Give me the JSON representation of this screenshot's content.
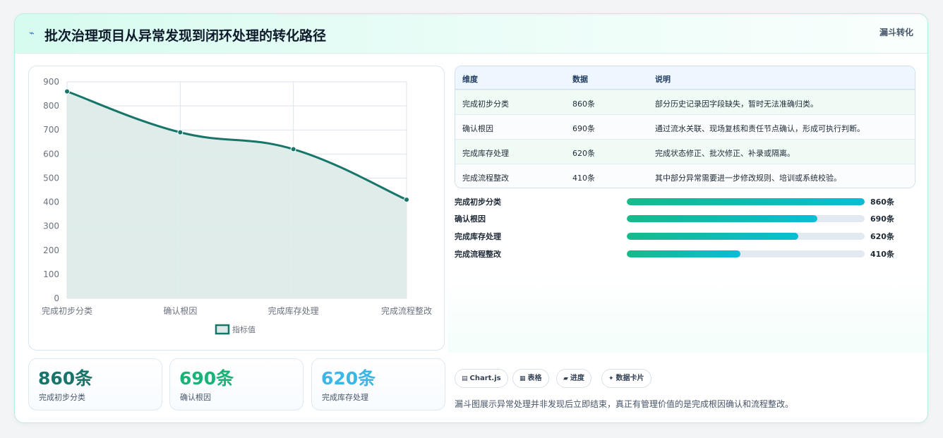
{
  "header": {
    "icon": "⌁",
    "icon_name": "trend-icon",
    "title": "批次治理项目从异常发现到闭环处理的转化路径",
    "badge": "漏斗转化"
  },
  "chart_data": {
    "type": "line",
    "categories": [
      "完成初步分类",
      "确认根因",
      "完成库存处理",
      "完成流程整改"
    ],
    "series": [
      {
        "name": "指标值",
        "values": [
          860,
          690,
          620,
          410
        ]
      }
    ],
    "ylim": [
      0,
      900
    ],
    "yticks": [
      0,
      100,
      200,
      300,
      400,
      500,
      600,
      700,
      800,
      900
    ],
    "fill": true,
    "grid": true,
    "legend": "bottom",
    "colors": {
      "line": "#17756a",
      "fill": "#dceae8",
      "grid": "#dbe3ec",
      "tick": "#6b7280"
    }
  },
  "stats": [
    {
      "value": "860条",
      "label": "完成初步分类",
      "color": "#17756a"
    },
    {
      "value": "690条",
      "label": "确认根因",
      "color": "#18b477"
    },
    {
      "value": "620条",
      "label": "完成库存处理",
      "color": "#3bb6e8"
    }
  ],
  "table": {
    "headers": [
      "维度",
      "数据",
      "说明"
    ],
    "rows": [
      [
        "完成初步分类",
        "860条",
        "部分历史记录因字段缺失，暂时无法准确归类。"
      ],
      [
        "确认根因",
        "690条",
        "通过流水关联、现场复核和责任节点确认，形成可执行判断。"
      ],
      [
        "完成库存处理",
        "620条",
        "完成状态修正、批次修正、补录或隔离。"
      ],
      [
        "完成流程整改",
        "410条",
        "其中部分异常需要进一步修改规则、培训或系统校验。"
      ]
    ]
  },
  "progress": [
    {
      "label": "完成初步分类",
      "value": 860,
      "max": 860,
      "text": "860条"
    },
    {
      "label": "确认根因",
      "value": 690,
      "max": 860,
      "text": "690条"
    },
    {
      "label": "完成库存处理",
      "value": 620,
      "max": 860,
      "text": "620条"
    },
    {
      "label": "完成流程整改",
      "value": 410,
      "max": 860,
      "text": "410条"
    }
  ],
  "chips": [
    {
      "icon": "▤",
      "icon_name": "chart-icon",
      "label": "Chart.js"
    },
    {
      "icon": "▦",
      "icon_name": "table-icon",
      "label": "表格"
    },
    {
      "icon": "▰",
      "icon_name": "progress-icon",
      "label": "进度"
    },
    {
      "icon": "✦",
      "icon_name": "sparkle-icon",
      "label": "数据卡片"
    }
  ],
  "summary": "漏斗图展示异常处理并非发现后立即结束，真正有管理价值的是完成根因确认和流程整改。",
  "colors": {
    "accent": "#17756a",
    "header_bg": "#d6fbef",
    "card_border": "#b9ece0"
  }
}
